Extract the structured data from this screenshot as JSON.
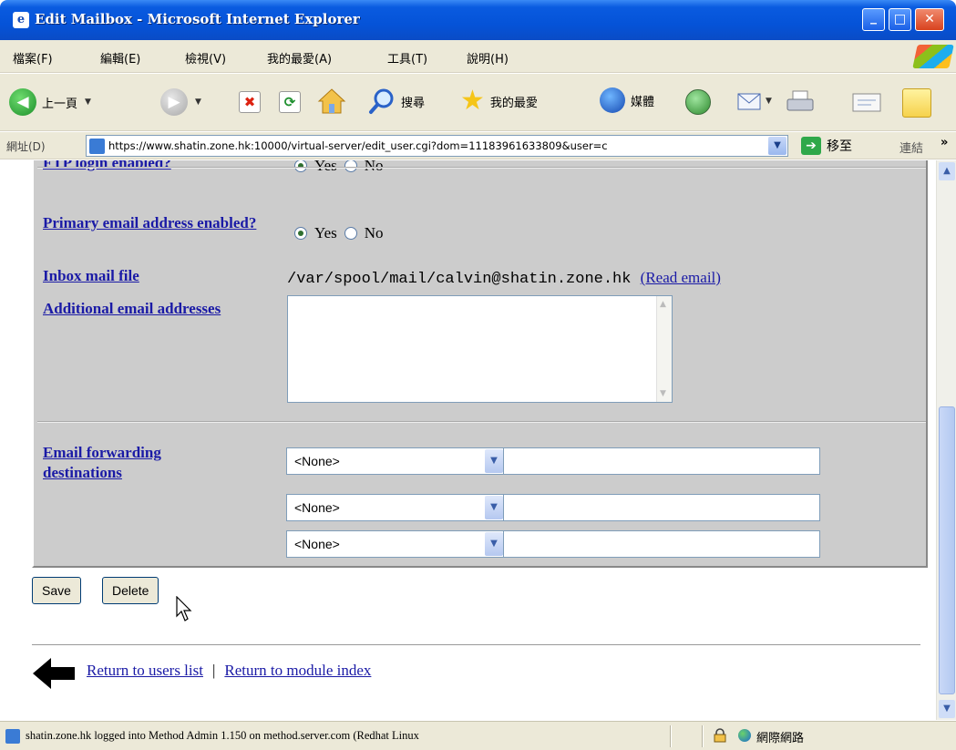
{
  "window": {
    "title": "Edit Mailbox - Microsoft Internet Explorer",
    "min_glyph": "_",
    "max_glyph": "□",
    "close_glyph": "✕"
  },
  "menu": [
    "檔案(F)",
    "編輯(E)",
    "檢視(V)",
    "我的最愛(A)",
    "工具(T)",
    "說明(H)"
  ],
  "toolbar": {
    "back_label": "上一頁",
    "search_label": "搜尋",
    "favorites_label": "我的最愛",
    "media_label": "媒體"
  },
  "address": {
    "label": "網址(D)",
    "url": "https://www.shatin.zone.hk:10000/virtual-server/edit_user.cgi?dom=11183961633809&user=c",
    "go_label": "移至",
    "links_label": "連結"
  },
  "form": {
    "ftp_label": "FTP login enabled?",
    "ftp_yes": "Yes",
    "ftp_no": "No",
    "ftp_selected": "Yes",
    "primary_label": "Primary email address enabled?",
    "primary_yes": "Yes",
    "primary_no": "No",
    "primary_selected": "Yes",
    "inbox_label": "Inbox mail file",
    "inbox_path": "/var/spool/mail/calvin@shatin.zone.hk",
    "read_email_link": "(Read email)",
    "additional_label": "Additional email addresses",
    "additional_value": "",
    "forwarding_label": "Email forwarding destinations",
    "forwarding": [
      {
        "select": "<None>",
        "value": ""
      },
      {
        "select": "<None>",
        "value": ""
      },
      {
        "select": "<None>",
        "value": ""
      }
    ]
  },
  "buttons": {
    "save": "Save",
    "delete": "Delete"
  },
  "footer": {
    "return_users": "Return to users list",
    "separator": "|",
    "return_module": "Return to module index"
  },
  "status": {
    "message": "shatin.zone.hk logged into Method Admin 1.150 on method.server.com (Redhat Linux",
    "zone": "網際網路"
  }
}
